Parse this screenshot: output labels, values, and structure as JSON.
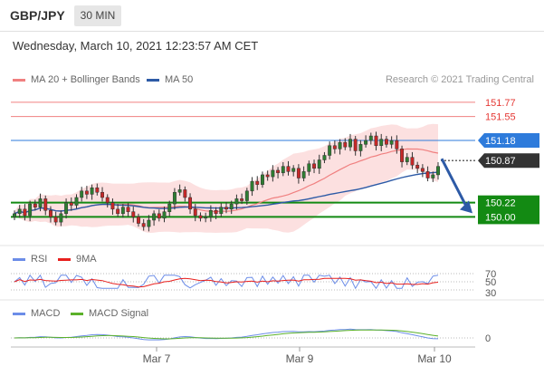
{
  "header": {
    "symbol": "GBP/JPY",
    "timeframe": "30 MIN"
  },
  "datetime": "Wednesday, March 10, 2021 12:23:57 AM CET",
  "legend": {
    "items": [
      {
        "label": "MA 20 + Bollinger Bands",
        "color": "#f08080"
      },
      {
        "label": "MA 50",
        "color": "#2d5aa6"
      }
    ],
    "credit": "Research © 2021 Trading Central"
  },
  "rsi_legend": [
    {
      "label": "RSI",
      "color": "#6c8de8"
    },
    {
      "label": "9MA",
      "color": "#e8201e"
    }
  ],
  "macd_legend": [
    {
      "label": "MACD",
      "color": "#6c8de8"
    },
    {
      "label": "MACD Signal",
      "color": "#5bb12a"
    }
  ],
  "chart_data": [
    {
      "type": "candlestick",
      "ylim": [
        149.6,
        151.95
      ],
      "x_labels": [
        "Mar 7",
        "Mar 9",
        "Mar 10"
      ],
      "current_price": {
        "value": 150.87,
        "label": "150.87",
        "color": "#333333"
      },
      "levels": [
        {
          "value": 151.77,
          "label": "151.77",
          "kind": "resistance",
          "color": "#f08080"
        },
        {
          "value": 151.55,
          "label": "151.55",
          "kind": "resistance",
          "color": "#f08080"
        },
        {
          "value": 151.18,
          "label": "151.18",
          "kind": "pivot",
          "color": "#2e7bdb"
        },
        {
          "value": 150.22,
          "label": "150.22",
          "kind": "support",
          "color": "#138a13"
        },
        {
          "value": 150.0,
          "label": "150.00",
          "kind": "support",
          "color": "#138a13"
        }
      ],
      "forecast_arrow": {
        "from": 150.87,
        "to": 150.0
      },
      "candle_colors": {
        "up": "#2e7d32",
        "down": "#c62828"
      },
      "close_series": [
        150.05,
        150.12,
        150.02,
        150.2,
        150.15,
        150.28,
        150.1,
        150.0,
        149.92,
        150.05,
        150.22,
        150.18,
        150.3,
        150.4,
        150.35,
        150.45,
        150.38,
        150.3,
        150.22,
        150.12,
        150.05,
        150.15,
        150.08,
        150.0,
        149.9,
        149.85,
        149.95,
        150.05,
        149.98,
        150.08,
        150.2,
        150.38,
        150.42,
        150.3,
        150.12,
        150.02,
        149.98,
        150.0,
        150.1,
        150.05,
        150.15,
        150.12,
        150.2,
        150.28,
        150.25,
        150.4,
        150.55,
        150.5,
        150.65,
        150.62,
        150.72,
        150.68,
        150.78,
        150.7,
        150.75,
        150.6,
        150.7,
        150.82,
        150.75,
        150.88,
        150.95,
        151.1,
        151.05,
        151.15,
        151.08,
        151.2,
        151.02,
        151.12,
        151.18,
        151.25,
        151.1,
        151.2,
        151.12,
        151.18,
        151.05,
        150.85,
        150.92,
        150.8,
        150.75,
        150.7,
        150.6,
        150.65,
        150.78
      ],
      "rsi_levels": [
        70,
        50,
        30
      ],
      "macd_zero_label": "0"
    }
  ]
}
